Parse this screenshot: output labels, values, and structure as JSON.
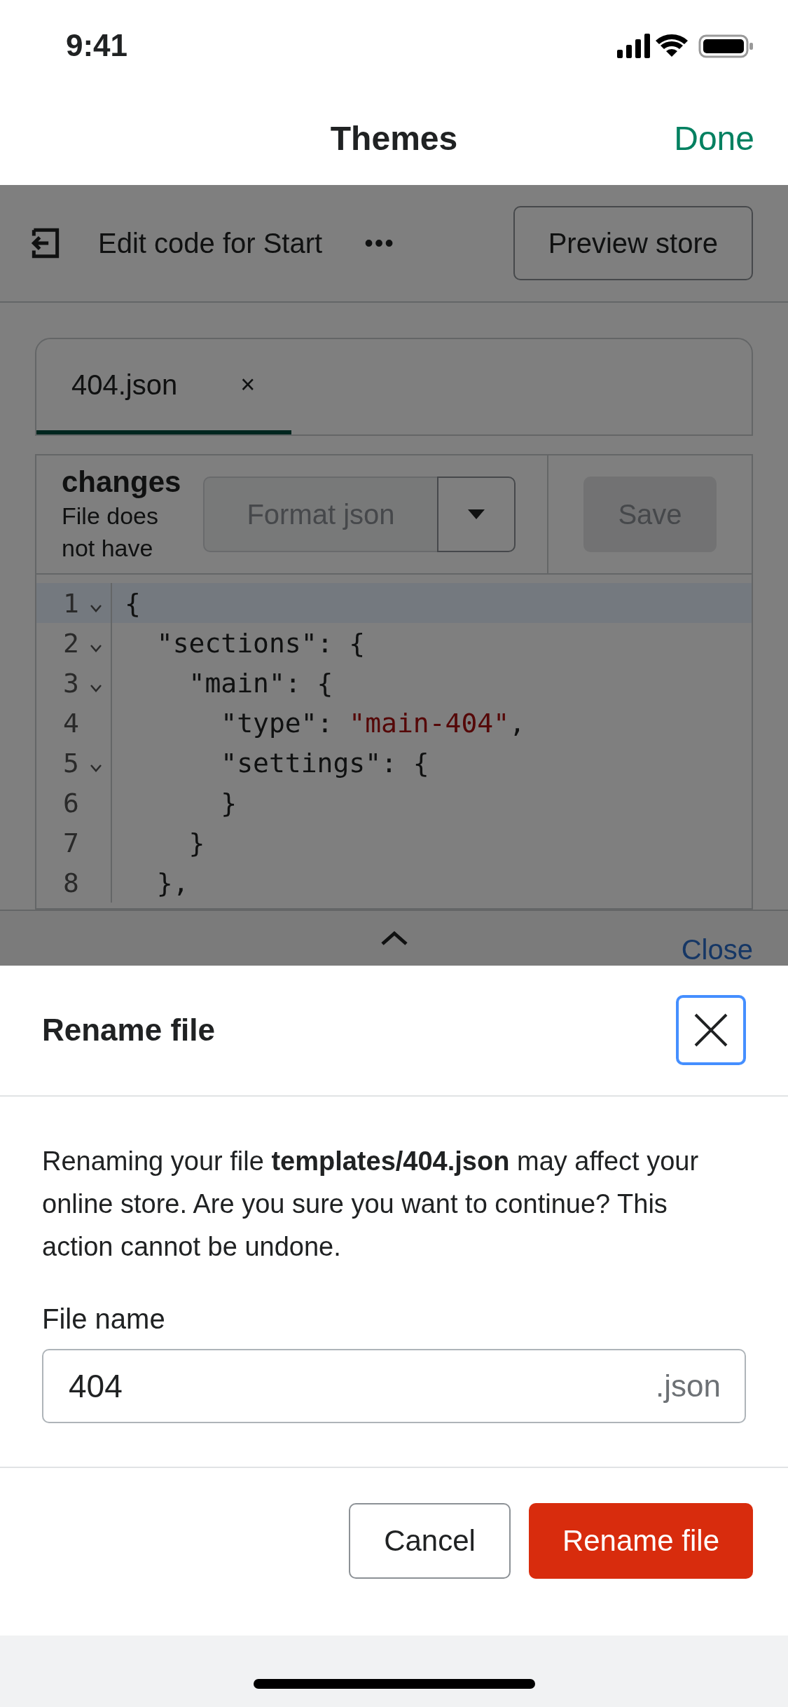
{
  "status_bar": {
    "time": "9:41"
  },
  "nav": {
    "title": "Themes",
    "done": "Done"
  },
  "toolbar": {
    "title": "Edit code for Start",
    "more": "•••",
    "preview": "Preview store"
  },
  "tabs": [
    {
      "label": "404.json",
      "close": "×",
      "selected": true
    }
  ],
  "editor_toolbar": {
    "heading": "changes",
    "note": "File does not have",
    "format": {
      "label": "Format json",
      "disabled": true
    },
    "save": {
      "label": "Save",
      "disabled": true
    }
  },
  "code_lines": [
    {
      "number": "1",
      "foldable": true,
      "active": true,
      "segments": [
        {
          "kind": "plain",
          "text": "{"
        }
      ]
    },
    {
      "number": "2",
      "foldable": true,
      "active": false,
      "segments": [
        {
          "kind": "plain",
          "text": "  \"sections\": {"
        }
      ]
    },
    {
      "number": "3",
      "foldable": true,
      "active": false,
      "segments": [
        {
          "kind": "plain",
          "text": "    \"main\": {"
        }
      ]
    },
    {
      "number": "4",
      "foldable": false,
      "active": false,
      "segments": [
        {
          "kind": "plain",
          "text": "      \"type\": "
        },
        {
          "kind": "string",
          "text": "\"main-404\""
        },
        {
          "kind": "plain",
          "text": ","
        }
      ]
    },
    {
      "number": "5",
      "foldable": true,
      "active": false,
      "segments": [
        {
          "kind": "plain",
          "text": "      \"settings\": {"
        }
      ]
    },
    {
      "number": "6",
      "foldable": false,
      "active": false,
      "segments": [
        {
          "kind": "plain",
          "text": "      }"
        }
      ]
    },
    {
      "number": "7",
      "foldable": false,
      "active": false,
      "segments": [
        {
          "kind": "plain",
          "text": "    }"
        }
      ]
    },
    {
      "number": "8",
      "foldable": false,
      "active": false,
      "segments": [
        {
          "kind": "plain",
          "text": "  },"
        }
      ]
    }
  ],
  "drawer": {
    "close": "Close"
  },
  "modal": {
    "title": "Rename file",
    "message": "Renaming your file **templates/404.json** may affect your online store. Are you sure you want to continue? This action cannot be undone.",
    "field_label": "File name",
    "field_value": "404",
    "field_suffix": ".json",
    "buttons": [
      {
        "label": "Cancel",
        "kind": "secondary"
      },
      {
        "label": "Rename file",
        "kind": "primary"
      }
    ]
  }
}
